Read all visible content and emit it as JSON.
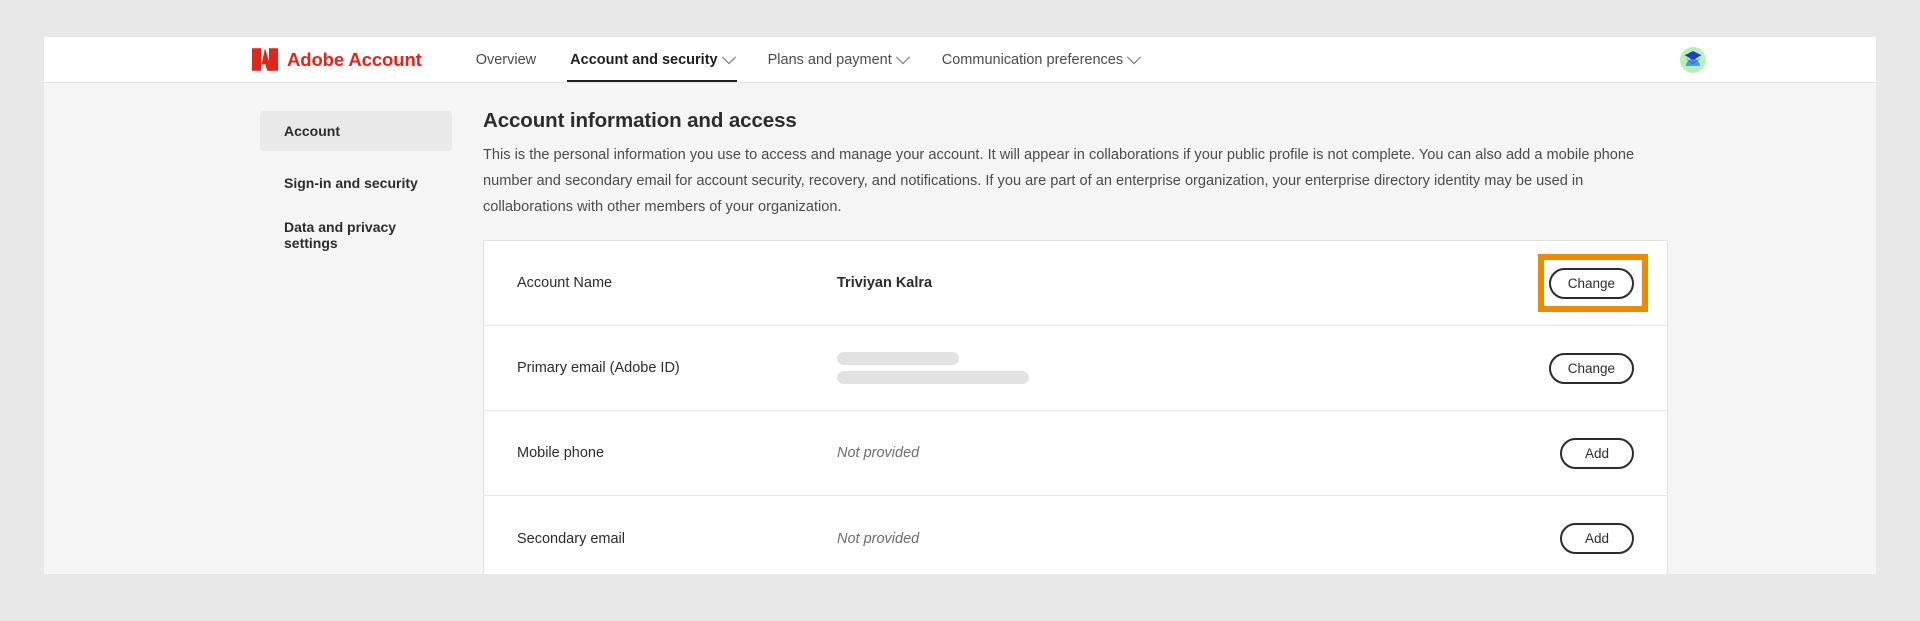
{
  "header": {
    "brand_name": "Adobe Account",
    "logo_icon": "adobe-logo-icon",
    "avatar_icon": "user-avatar-icon",
    "nav": [
      {
        "label": "Overview",
        "has_chevron": false,
        "active": false
      },
      {
        "label": "Account and security",
        "has_chevron": true,
        "active": true
      },
      {
        "label": "Plans and payment",
        "has_chevron": true,
        "active": false
      },
      {
        "label": "Communication preferences",
        "has_chevron": true,
        "active": false
      }
    ]
  },
  "sidebar": {
    "items": [
      {
        "label": "Account",
        "selected": true
      },
      {
        "label": "Sign-in and security",
        "selected": false
      },
      {
        "label": "Data and privacy settings",
        "selected": false
      }
    ]
  },
  "main": {
    "title": "Account information and access",
    "description": "This is the personal information you use to access and manage your account. It will appear in collaborations if your public profile is not complete. You can also add a mobile phone number and secondary email for account security, recovery, and notifications. If you are part of an enterprise organization, your enterprise directory identity may be used in collaborations with other members of your organization.",
    "rows": [
      {
        "label": "Account Name",
        "value": "Triviyan Kalra",
        "value_kind": "text",
        "action": "Change",
        "highlighted": true
      },
      {
        "label": "Primary email (Adobe ID)",
        "value": "",
        "value_kind": "redacted",
        "action": "Change",
        "highlighted": false
      },
      {
        "label": "Mobile phone",
        "value": "Not provided",
        "value_kind": "muted",
        "action": "Add",
        "highlighted": false
      },
      {
        "label": "Secondary email",
        "value": "Not provided",
        "value_kind": "muted",
        "action": "Add",
        "highlighted": false
      }
    ]
  },
  "colors": {
    "adobe_red": "#e1251b",
    "highlight_orange": "#ED8B00",
    "page_background": "#f5f5f5",
    "card_background": "#ffffff",
    "text_primary": "#2c2c2c",
    "text_secondary": "#4b4b4b"
  }
}
